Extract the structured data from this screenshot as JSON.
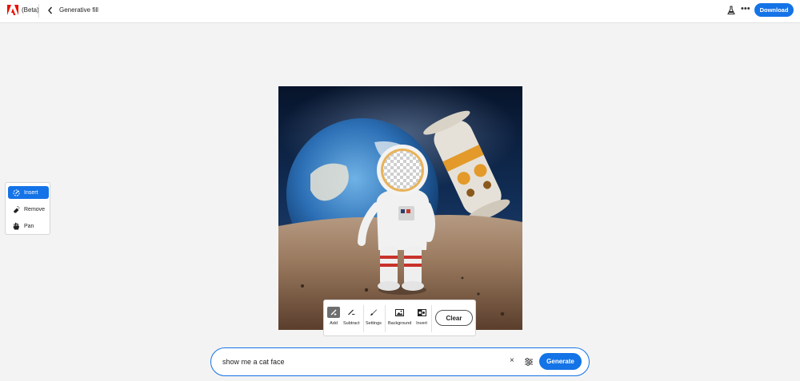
{
  "header": {
    "logo_icon": "adobe-logo-icon",
    "beta_label": "(Beta)",
    "back_icon": "chevron-left-icon",
    "title": "Generative fill",
    "labs_icon": "flask-icon",
    "more_label": "•••",
    "download_label": "Download"
  },
  "tools": [
    {
      "label": "Insert",
      "icon": "insert-brush-icon",
      "active": true
    },
    {
      "label": "Remove",
      "icon": "remove-eraser-icon",
      "active": false
    },
    {
      "label": "Pan",
      "icon": "hand-icon",
      "active": false
    }
  ],
  "selection_bar": {
    "buttons": [
      {
        "label": "Add",
        "icon": "add-brush-icon",
        "active": true
      },
      {
        "label": "Subtract",
        "icon": "subtract-brush-icon",
        "active": false
      },
      {
        "label": "Settings",
        "icon": "brush-settings-icon",
        "active": false
      },
      {
        "label": "Background",
        "icon": "background-image-icon",
        "active": false
      },
      {
        "label": "Invert",
        "icon": "invert-icon",
        "active": false
      }
    ],
    "clear_label": "Clear"
  },
  "prompt": {
    "value": "show me a cat face",
    "clear_icon": "close-icon",
    "clear_label": "×",
    "settings_icon": "sliders-icon",
    "generate_label": "Generate"
  },
  "colors": {
    "accent": "#1473e6",
    "adobe_red": "#eb1000"
  }
}
